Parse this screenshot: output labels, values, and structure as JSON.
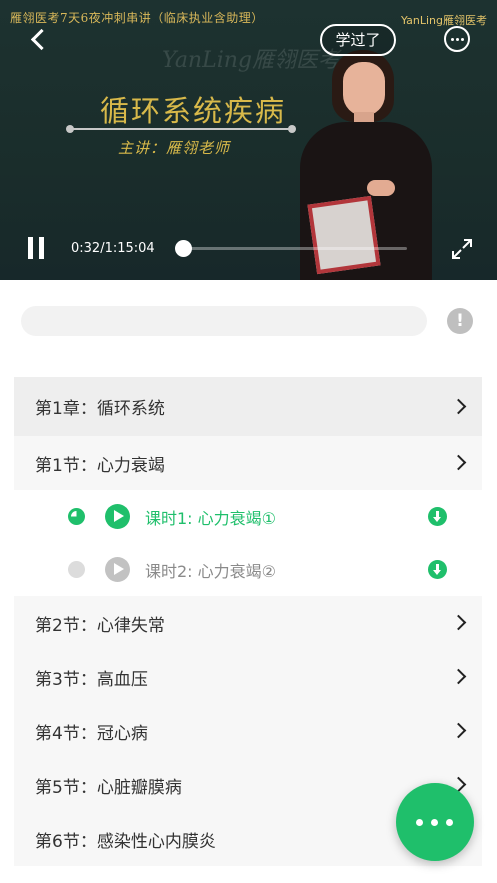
{
  "colors": {
    "accent": "#1fbf6b",
    "inactive": "#c2c2c2",
    "text": "#333333",
    "chapter_bg": "#eeeeee",
    "section_bg": "#f7f7f7"
  },
  "video": {
    "banner_text": "雁翎医考7天6夜冲刺串讲（临床执业含助理）",
    "brand_top": "YanLing雁翎医考",
    "watermark": "YanLing雁翎医考",
    "slide_title": "循环系统疾病",
    "presenter_line": "主讲：雁翎老师",
    "learned_button": "学过了",
    "current_time": "0:32",
    "duration": "1:15:04",
    "time_display": "0:32/1:15:04",
    "progress_fraction": 0.007,
    "icons": {
      "back": "back-arrow-icon",
      "more": "more-dots-icon",
      "pause": "pause-icon",
      "fullscreen": "fullscreen-icon"
    }
  },
  "comment": {
    "placeholder": ""
  },
  "list": {
    "chapter": {
      "label": "第1章：循环系统"
    },
    "section1": {
      "label": "第1节：心力衰竭"
    },
    "lessons": [
      {
        "label": "课时1: 心力衰竭①",
        "state": "playing",
        "color": "#1fbf6b"
      },
      {
        "label": "课时2: 心力衰竭②",
        "state": "not-started",
        "color": "#c2c2c2"
      }
    ],
    "sections": [
      {
        "label": "第2节：心律失常"
      },
      {
        "label": "第3节：高血压"
      },
      {
        "label": "第4节：冠心病"
      },
      {
        "label": "第5节：心脏瓣膜病"
      },
      {
        "label": "第6节：感染性心内膜炎"
      }
    ]
  }
}
